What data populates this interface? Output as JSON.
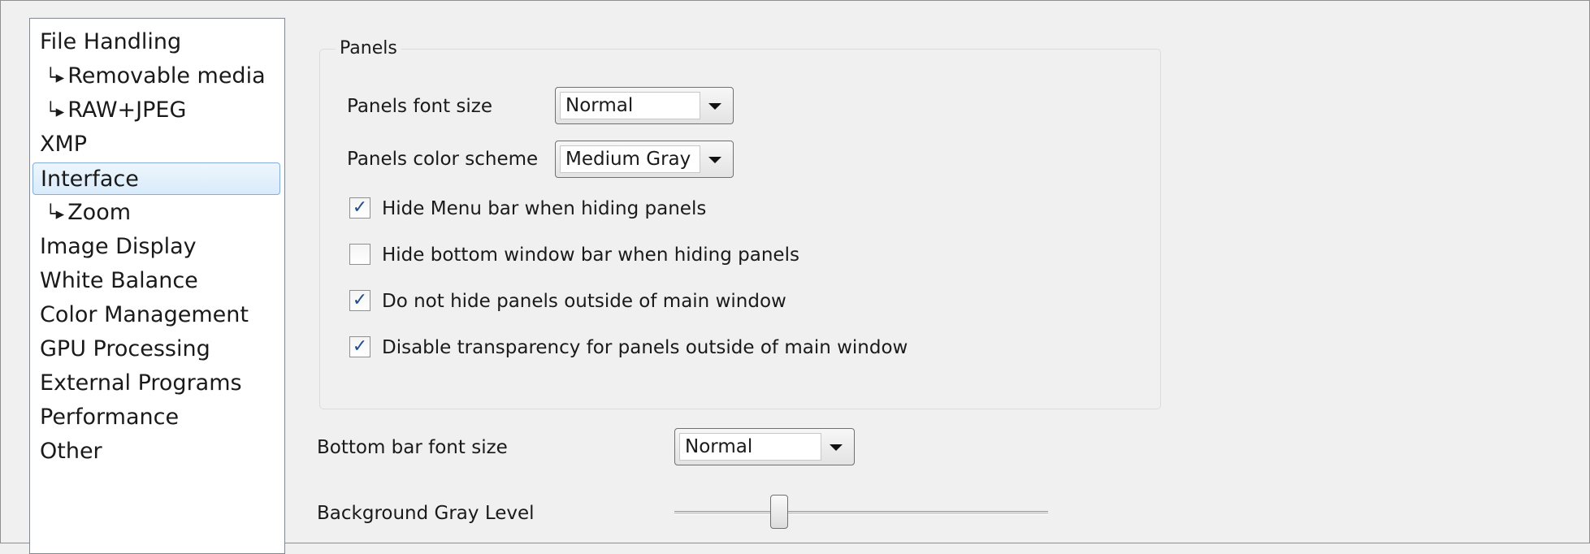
{
  "sidebar": {
    "items": [
      {
        "label": "File Handling",
        "child": false,
        "selected": false
      },
      {
        "label": "Removable media",
        "child": true,
        "selected": false
      },
      {
        "label": "RAW+JPEG",
        "child": true,
        "selected": false
      },
      {
        "label": "XMP",
        "child": false,
        "selected": false
      },
      {
        "label": "Interface",
        "child": false,
        "selected": true
      },
      {
        "label": "Zoom",
        "child": true,
        "selected": false
      },
      {
        "label": "Image Display",
        "child": false,
        "selected": false
      },
      {
        "label": "White Balance",
        "child": false,
        "selected": false
      },
      {
        "label": "Color Management",
        "child": false,
        "selected": false
      },
      {
        "label": "GPU Processing",
        "child": false,
        "selected": false
      },
      {
        "label": "External Programs",
        "child": false,
        "selected": false
      },
      {
        "label": "Performance",
        "child": false,
        "selected": false
      },
      {
        "label": "Other",
        "child": false,
        "selected": false
      }
    ],
    "child_arrow_icon": "child-arrow-icon",
    "child_arrow_glyph": "└▸"
  },
  "panels": {
    "group_title": "Panels",
    "font_size": {
      "label": "Panels font size",
      "value": "Normal"
    },
    "color_scheme": {
      "label": "Panels color scheme",
      "value": "Medium Gray"
    },
    "checkboxes": [
      {
        "label": "Hide Menu bar when hiding panels",
        "checked": true
      },
      {
        "label": "Hide bottom window bar when hiding panels",
        "checked": false
      },
      {
        "label": "Do not hide panels outside of main window",
        "checked": true
      },
      {
        "label": "Disable transparency for panels outside of main window",
        "checked": true
      }
    ]
  },
  "bottom_bar": {
    "label": "Bottom bar font size",
    "value": "Normal"
  },
  "background_gray": {
    "label": "Background Gray Level",
    "level_fraction": 0.28
  },
  "colors": {
    "selection_bg": "#d9ebfb",
    "selection_border": "#84acdd",
    "check_mark": "#1f4d8d"
  }
}
